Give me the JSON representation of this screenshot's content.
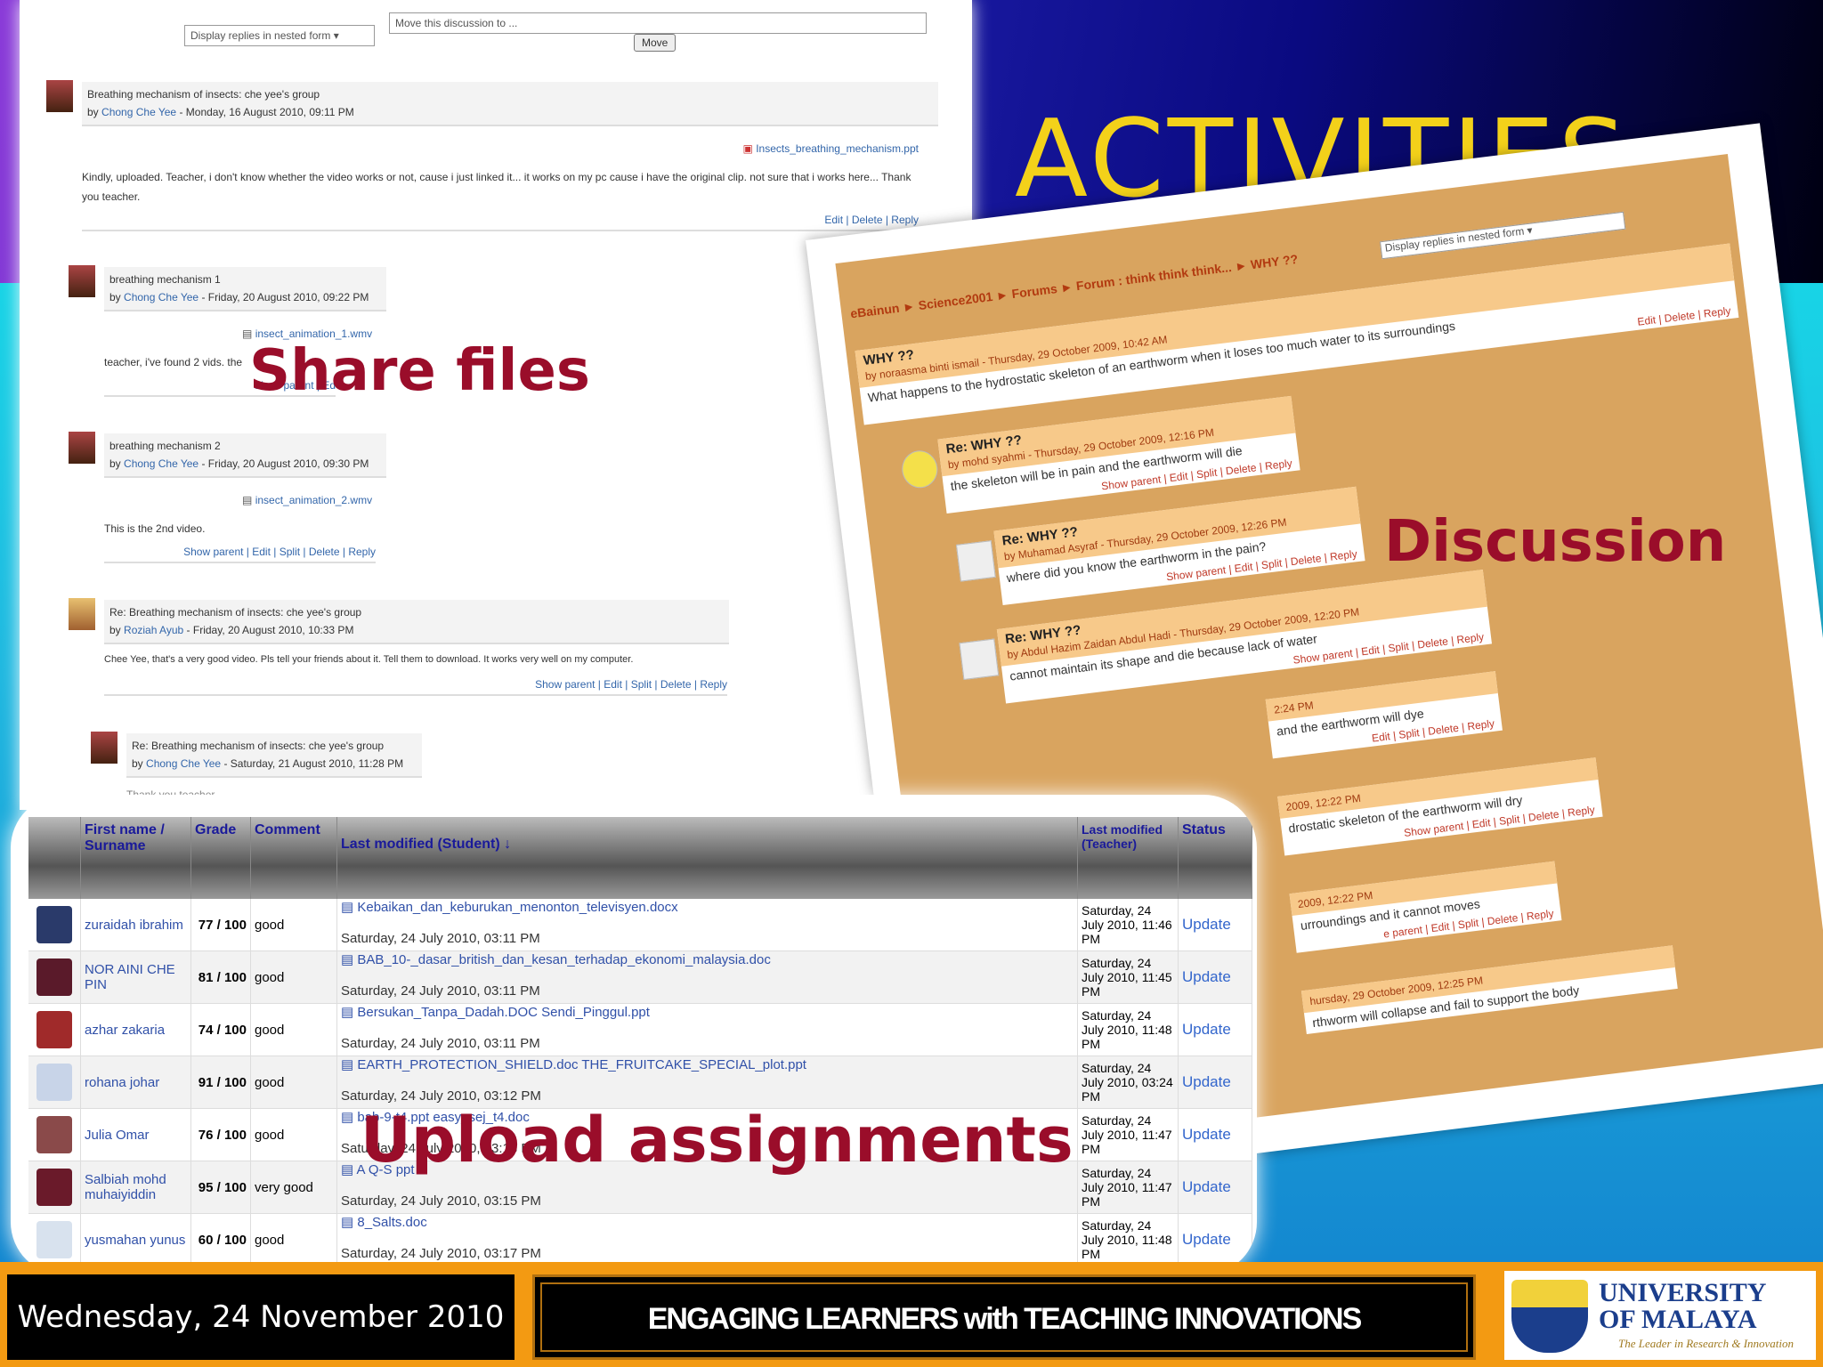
{
  "slide": {
    "title": "ACTIVITIES"
  },
  "labels": {
    "share": "Share files",
    "discussion": "Discussion",
    "upload": "Upload assignments"
  },
  "forum": {
    "display_select": "Display replies in nested form",
    "move_select": "Move this discussion to ...",
    "move_button": "Move",
    "posts": [
      {
        "subject": "Breathing mechanism of insects: che yee's group",
        "by_prefix": "by",
        "author": "Chong Che Yee",
        "date": "- Monday, 16 August 2010, 09:11 PM",
        "attachment": "Insects_breathing_mechanism.ppt",
        "body": "Kindly, uploaded. Teacher, i don't know whether the video works or not, cause i just linked it... it works on my pc cause i have the original clip. not sure that i works here... Thank you teacher.",
        "actions": "Edit | Delete | Reply"
      },
      {
        "subject": "breathing mechanism 1",
        "by_prefix": "by",
        "author": "Chong Che Yee",
        "date": "- Friday, 20 August 2010, 09:22 PM",
        "attachment": "insect_animation_1.wmv",
        "body": "teacher, i've found 2 vids. the",
        "actions": "Show parent | Ed"
      },
      {
        "subject": "breathing mechanism 2",
        "by_prefix": "by",
        "author": "Chong Che Yee",
        "date": "- Friday, 20 August 2010, 09:30 PM",
        "attachment": "insect_animation_2.wmv",
        "body": "This is the 2nd video.",
        "actions": "Show parent | Edit | Split | Delete | Reply"
      },
      {
        "subject": "Re: Breathing mechanism of insects: che yee's group",
        "by_prefix": "by",
        "author": "Roziah Ayub",
        "date": "- Friday, 20 August 2010, 10:33 PM",
        "body": "Chee Yee, that's a very good video. Pls tell your friends about it. Tell them to download. It works very well on my computer.",
        "actions": "Show parent | Edit | Split | Delete | Reply"
      },
      {
        "subject": "Re: Breathing mechanism of insects: che yee's group",
        "by_prefix": "by",
        "author": "Chong Che Yee",
        "date": "- Saturday, 21 August 2010, 11:28 PM",
        "body": "Thank you teacher"
      }
    ]
  },
  "discussion": {
    "breadcrumb": "eBainun ► Science2001 ► Forums ► Forum : think think think... ► WHY ??",
    "select": "Display replies in nested form",
    "posts": [
      {
        "title": "WHY ??",
        "meta": "by noraasma binti ismail - Thursday, 29 October 2009, 10:42 AM",
        "body": "What happens to the hydrostatic skeleton of an earthworm when it loses too much water to its surroundings",
        "actions": "Edit | Delete | Reply"
      },
      {
        "title": "Re: WHY ??",
        "meta": "by mohd syahmi - Thursday, 29 October 2009, 12:16 PM",
        "body": "the skeleton will be in pain and the earthworm will die",
        "actions": "Show parent | Edit | Split | Delete | Reply"
      },
      {
        "title": "Re: WHY ??",
        "meta": "by Muhamad Asyraf - Thursday, 29 October 2009, 12:26 PM",
        "body": "where did you know the earthworm in the pain?",
        "actions": "Show parent | Edit | Split | Delete | Reply"
      },
      {
        "title": "Re: WHY ??",
        "meta": "by Abdul Hazim Zaidan Abdul Hadi - Thursday, 29 October 2009, 12:20 PM",
        "body": "cannot maintain its shape and die because lack of water",
        "actions": "Show parent | Edit | Split | Delete | Reply"
      },
      {
        "title": "",
        "meta": "2:24 PM",
        "body": "and the earthworm will dye",
        "actions": "Edit | Split | Delete | Reply"
      },
      {
        "title": "",
        "meta": "2009, 12:22 PM",
        "body": "drostatic skeleton of the earthworm will dry",
        "actions": "Show parent | Edit | Split | Delete | Reply"
      },
      {
        "title": "",
        "meta": "2009, 12:22 PM",
        "body": "urroundings and it cannot moves",
        "actions": "e parent | Edit | Split | Delete | Reply"
      },
      {
        "title": "",
        "meta": "hursday, 29 October 2009, 12:25 PM",
        "body": "rthworm will collapse and fail to support the body",
        "actions": ""
      }
    ]
  },
  "grades": {
    "headers": {
      "name": "First name / Surname",
      "grade": "Grade",
      "comment": "Comment",
      "last_student": "Last modified (Student)",
      "last_teacher": "Last modified (Teacher)",
      "status": "Status"
    },
    "rows": [
      {
        "name": "zuraidah ibrahim",
        "grade": "77 / 100",
        "comment": "good",
        "files": "Kebaikan_dan_keburukan_menonton_televisyen.docx",
        "date": "Saturday, 24 July 2010, 03:11 PM",
        "teacher": "Saturday, 24 July 2010, 11:46 PM",
        "status": "Update",
        "color": "#2a3a6a"
      },
      {
        "name": "NOR AINI CHE PIN",
        "grade": "81 / 100",
        "comment": "good",
        "files": "BAB_10-_dasar_british_dan_kesan_terhadap_ekonomi_malaysia.doc",
        "date": "Saturday, 24 July 2010, 03:11 PM",
        "teacher": "Saturday, 24 July 2010, 11:45 PM",
        "status": "Update",
        "color": "#5a1a2a"
      },
      {
        "name": "azhar zakaria",
        "grade": "74 / 100",
        "comment": "good",
        "files": "Bersukan_Tanpa_Dadah.DOC  Sendi_Pinggul.ppt",
        "date": "Saturday, 24 July 2010, 03:11 PM",
        "teacher": "Saturday, 24 July 2010, 11:48 PM",
        "status": "Update",
        "color": "#a02a2a"
      },
      {
        "name": "rohana johar",
        "grade": "91 / 100",
        "comment": "good",
        "files": "EARTH_PROTECTION_SHIELD.doc  THE_FRUITCAKE_SPECIAL_plot.ppt",
        "date": "Saturday, 24 July 2010, 03:12 PM",
        "teacher": "Saturday, 24 July 2010, 03:24 PM",
        "status": "Update",
        "color": "#c8d4e8"
      },
      {
        "name": "Julia Omar",
        "grade": "76 / 100",
        "comment": "good",
        "files": "bab-9-t4.ppt  easy_sej_t4.doc",
        "date": "Saturday, 24 July 2010, 03:13 PM",
        "teacher": "Saturday, 24 July 2010, 11:47 PM",
        "status": "Update",
        "color": "#8a4a4a"
      },
      {
        "name": "Salbiah mohd muhaiyiddin",
        "grade": "95 / 100",
        "comment": "very good",
        "files": "A                  Q-S                                          ppt",
        "date": "Saturday, 24 July 2010, 03:15 PM",
        "teacher": "Saturday, 24 July 2010, 11:47 PM",
        "status": "Update",
        "color": "#6a1a2a"
      },
      {
        "name": "yusmahan yunus",
        "grade": "60 / 100",
        "comment": "good",
        "files": "8_Salts.doc",
        "date": "Saturday, 24 July 2010, 03:17 PM",
        "teacher": "Saturday, 24 July 2010, 11:48 PM",
        "status": "Update",
        "color": "#d8e2ee"
      }
    ]
  },
  "footer": {
    "date": "Wednesday, 24 November 2010",
    "tagline": "ENGAGING LEARNERS with TEACHING INNOVATIONS",
    "logo_line1": "UNIVERSITY",
    "logo_line2": "OF MALAYA",
    "logo_motto": "The Leader in Research & Innovation"
  }
}
